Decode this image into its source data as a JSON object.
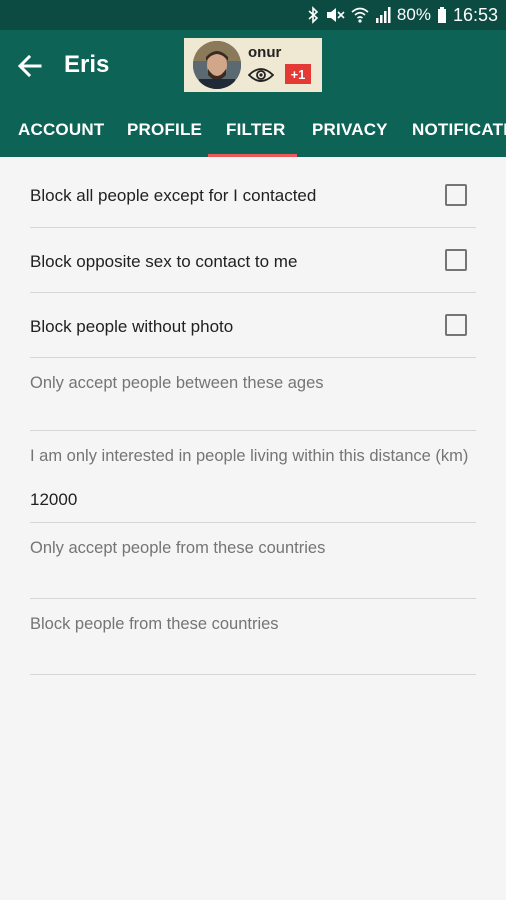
{
  "status_bar": {
    "battery": "80%",
    "time": "16:53",
    "icons": [
      "bluetooth-icon",
      "mute-icon",
      "wifi-icon",
      "signal-icon",
      "battery-icon"
    ]
  },
  "app_bar": {
    "title": "Eris",
    "profile": {
      "name": "onur",
      "badge": "+1"
    },
    "tabs": [
      {
        "label": "ACCOUNT"
      },
      {
        "label": "PROFILE"
      },
      {
        "label": "FILTER"
      },
      {
        "label": "PRIVACY"
      },
      {
        "label": "NOTIFICATIONS"
      }
    ],
    "active_tab": "FILTER"
  },
  "filter": {
    "checkboxes": [
      {
        "label": "Block all people except for I contacted",
        "checked": false
      },
      {
        "label": "Block opposite sex to contact to me",
        "checked": false
      },
      {
        "label": "Block people without photo",
        "checked": false
      }
    ],
    "fields": [
      {
        "label": "Only accept people between these ages",
        "value": ""
      },
      {
        "label": "I am only interested in people living within this distance (km)",
        "value": "12000"
      },
      {
        "label": "Only accept people from these countries",
        "value": ""
      },
      {
        "label": "Block people from these countries",
        "value": ""
      }
    ]
  },
  "colors": {
    "status_bar": "#0b4b41",
    "app_bar": "#0e6357",
    "tab_indicator": "#ea5a5a",
    "badge": "#e53935"
  }
}
